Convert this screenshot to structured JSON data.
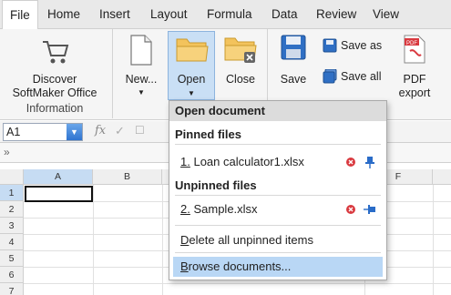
{
  "menubar": {
    "items": [
      "File",
      "Home",
      "Insert",
      "Layout",
      "Formula",
      "Data",
      "Review",
      "View"
    ],
    "active": "File"
  },
  "ribbon": {
    "discover_label_1": "Discover",
    "discover_label_2": "SoftMaker Office",
    "information_group": "Information",
    "new_label": "New...",
    "open_label": "Open",
    "close_label": "Close",
    "save_label": "Save",
    "save_as_label": "Save as",
    "save_all_label": "Save all",
    "pdf_label_1": "PDF",
    "pdf_label_2": "export"
  },
  "formula_bar": {
    "cell_ref": "A1",
    "fx": "fx",
    "check": "✓",
    "cancel": "☐"
  },
  "collapse_row": {
    "glyph": "»"
  },
  "grid": {
    "columns": [
      "A",
      "B",
      "F"
    ],
    "rows": [
      "1",
      "2",
      "3",
      "4",
      "5",
      "6",
      "7"
    ]
  },
  "open_menu": {
    "title": "Open document",
    "pinned_header": "Pinned files",
    "pinned": [
      {
        "num": "1.",
        "name": "Loan calculator1.xlsx"
      }
    ],
    "unpinned_header": "Unpinned files",
    "unpinned": [
      {
        "num": "2.",
        "name": "Sample.xlsx"
      }
    ],
    "delete_unpinned_first": "D",
    "delete_unpinned_rest": "elete all unpinned items",
    "browse_first": "B",
    "browse_rest": "rowse documents..."
  },
  "colors": {
    "accent_blue": "#2f74d0",
    "highlight": "#b9d7f5",
    "pin_red": "#d9393f",
    "pin_blue": "#2a6cc8"
  }
}
